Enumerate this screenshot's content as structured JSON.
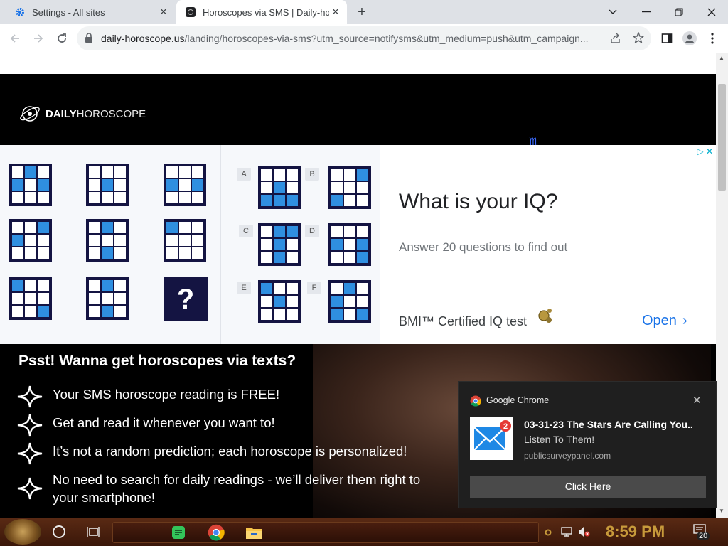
{
  "tabs": [
    {
      "title": "Settings - All sites",
      "icon": "gear-icon"
    },
    {
      "title": "Horoscopes via SMS | Daily-ho",
      "icon": "site-favicon"
    }
  ],
  "toolbar": {
    "url_host": "daily-horoscope.us",
    "url_path": "/landing/horoscopes-via-sms?utm_source=notifysms&utm_medium=push&utm_campaign..."
  },
  "page": {
    "logo_bold": "DAILY",
    "logo_light": "HOROSCOPE",
    "pitch_title": "Psst! Wanna get horoscopes via texts?",
    "features": [
      "Your SMS horoscope reading is FREE!",
      "Get and read it whenever you want to!",
      "It’s not a random prediction; each horoscope is personalized!",
      "No need to search for daily readings - we’ll deliver them right to your smartphone!"
    ]
  },
  "ad": {
    "heading": "What is your IQ?",
    "subheading": "Answer 20 questions to find out",
    "brand": "BMI™ Certified IQ test",
    "cta": "Open",
    "question_mark": "?",
    "option_labels": [
      "A",
      "B",
      "C",
      "D",
      "E",
      "F"
    ]
  },
  "notification": {
    "app": "Google Chrome",
    "title": "03-31-23 The Stars Are Calling You..",
    "body": "Listen To Them!",
    "source": "publicsurveypanel.com",
    "button": "Click Here",
    "badge_count": "2"
  },
  "taskbar": {
    "clock": "8:59 PM",
    "notification_count": "20"
  }
}
